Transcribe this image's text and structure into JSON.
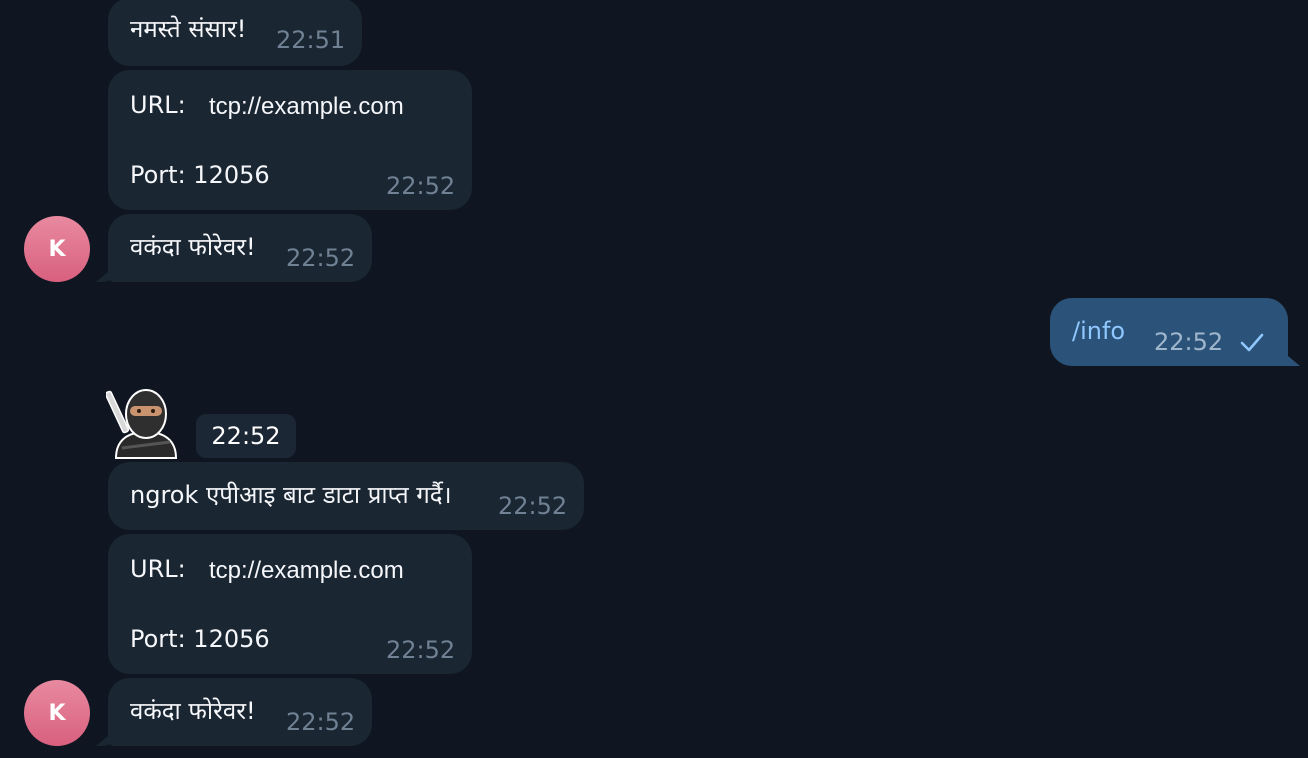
{
  "messages": [
    {
      "text": "नमस्ते संसार!",
      "time": "22:51"
    },
    {
      "url_label": "URL:",
      "url_value": "tcp://example.com",
      "port_line": "Port: 12056",
      "time": "22:52"
    },
    {
      "text": "वकंदा फोरेवर!",
      "time": "22:52",
      "avatar_initial": "K"
    },
    {
      "text": "/info",
      "time": "22:52",
      "status": "sent-check-icon"
    },
    {
      "sticker": "ninja-sticker",
      "time": "22:52"
    },
    {
      "text": "ngrok एपीआइ बाट डाटा प्राप्त गर्दै।",
      "time": "22:52"
    },
    {
      "url_label": "URL:",
      "url_value": "tcp://example.com",
      "port_line": "Port: 12056",
      "time": "22:52"
    },
    {
      "text": "वकंदा फोरेवर!",
      "time": "22:52",
      "avatar_initial": "K"
    }
  ],
  "colors": {
    "background": "#0f1621",
    "incoming_bubble": "#1b2633",
    "outgoing_bubble": "#2b5278",
    "time_text": "#6f8193",
    "outgoing_text": "#8fc7ff",
    "avatar": "#e07a92"
  }
}
